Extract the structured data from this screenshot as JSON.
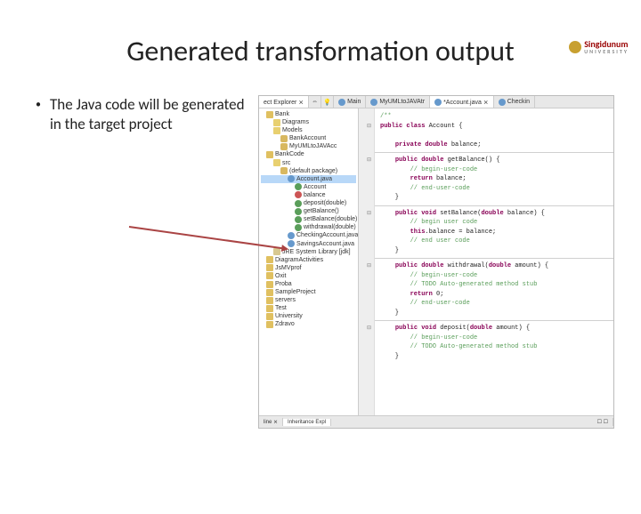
{
  "logo": {
    "name": "Singidunum",
    "sub": "UNIVERSITY"
  },
  "title": "Generated transformation output",
  "bullet": "The Java code will be generated in the target project",
  "ide": {
    "tabs_left": "ect Explorer ⨯",
    "tabs_right": [
      {
        "icon": "java",
        "label": "Main"
      },
      {
        "icon": "java",
        "label": "MyUMLtoJAVAtr"
      },
      {
        "icon": "java",
        "label": "*Account.java ⨯"
      },
      {
        "icon": "java",
        "label": "Checkin"
      }
    ],
    "tree": [
      {
        "cls": "ind1",
        "icon": "prj",
        "label": "Bank"
      },
      {
        "cls": "ind2",
        "icon": "folder",
        "label": "Diagrams"
      },
      {
        "cls": "ind2",
        "icon": "folder",
        "label": "Models"
      },
      {
        "cls": "ind3",
        "icon": "pkg",
        "label": "BankAccount"
      },
      {
        "cls": "ind3",
        "icon": "pkg",
        "label": "MyUMLtoJAVAcc"
      },
      {
        "cls": "ind1",
        "icon": "prj",
        "label": "BankCode"
      },
      {
        "cls": "ind2",
        "icon": "folder",
        "label": "src"
      },
      {
        "cls": "ind3",
        "icon": "pkg",
        "label": "(default package)"
      },
      {
        "cls": "ind4 sel",
        "icon": "java",
        "label": "Account.java"
      },
      {
        "cls": "ind5",
        "icon": "class",
        "label": "Account"
      },
      {
        "cls": "ind5",
        "icon": "field",
        "label": "balance"
      },
      {
        "cls": "ind5",
        "icon": "method",
        "label": "deposit(double)"
      },
      {
        "cls": "ind5",
        "icon": "method",
        "label": "getBalance()"
      },
      {
        "cls": "ind5",
        "icon": "method",
        "label": "setBalance(double)"
      },
      {
        "cls": "ind5",
        "icon": "method",
        "label": "withdrawal(double)"
      },
      {
        "cls": "ind4",
        "icon": "java",
        "label": "CheckingAccount.java"
      },
      {
        "cls": "ind4",
        "icon": "java",
        "label": "SavingsAccount.java"
      },
      {
        "cls": "ind2",
        "icon": "lib",
        "label": "JRE System Library [jdk]"
      },
      {
        "cls": "ind1",
        "icon": "prj",
        "label": "DiagramActivities"
      },
      {
        "cls": "ind1",
        "icon": "prj",
        "label": "JsMVprof"
      },
      {
        "cls": "ind1",
        "icon": "prj",
        "label": "Oxit"
      },
      {
        "cls": "ind1",
        "icon": "prj",
        "label": "Proba"
      },
      {
        "cls": "ind1",
        "icon": "prj",
        "label": "SampleProject"
      },
      {
        "cls": "ind1",
        "icon": "prj",
        "label": "servers"
      },
      {
        "cls": "ind1",
        "icon": "prj",
        "label": "Test"
      },
      {
        "cls": "ind1",
        "icon": "prj",
        "label": "University"
      },
      {
        "cls": "ind1",
        "icon": "prj",
        "label": "Zdravo"
      }
    ],
    "code": {
      "l01": "/**",
      "l02": "public class Account {",
      "l03": "    private double balance;",
      "l04": "    public double getBalance() {",
      "l05": "        // begin-user-code",
      "l06": "        return balance;",
      "l07": "        // end-user-code",
      "l08": "    }",
      "l09": "    public void setBalance(double balance) {",
      "l10": "        // begin user code",
      "l11": "        this.balance = balance;",
      "l12": "        // end user code",
      "l13": "    }",
      "l14": "    public double withdrawal(double amount) {",
      "l15": "        // begin-user-code",
      "l16": "        // TODO Auto-generated method stub",
      "l17": "        return 0;",
      "l18": "        // end-user-code",
      "l19": "    }",
      "l20": "    public void deposit(double amount) {",
      "l21": "        // begin-user-code",
      "l22": "        // TODO Auto-generated method stub",
      "l23": "    }"
    },
    "bottom_tabs": [
      "line ⨯",
      "Inheritance Expl"
    ]
  }
}
